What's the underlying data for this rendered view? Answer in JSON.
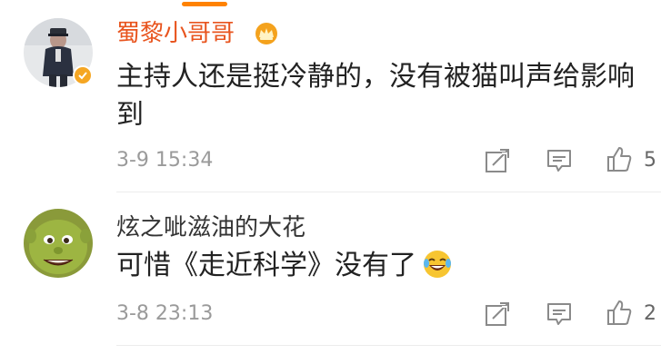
{
  "comments": [
    {
      "username": "蜀黎小哥哥",
      "username_color": "#e8541e",
      "avatar": "police-officer-avatar",
      "verified": true,
      "text": "主持人还是挺冷静的，没有被猫叫声给影响到",
      "time": "3-9 15:34",
      "likes": "5"
    },
    {
      "username": "炫之呲滋油的大花",
      "username_color": "#333333",
      "avatar": "green-ogre-avatar",
      "verified": false,
      "text": "可惜《走近科学》没有了",
      "emoji": "laughing-tears-emoji",
      "time": "3-8 23:13",
      "likes": "2"
    }
  ],
  "colors": {
    "accent": "#ff8200",
    "icon": "#8a8a8a",
    "time": "#9a9a9a"
  }
}
